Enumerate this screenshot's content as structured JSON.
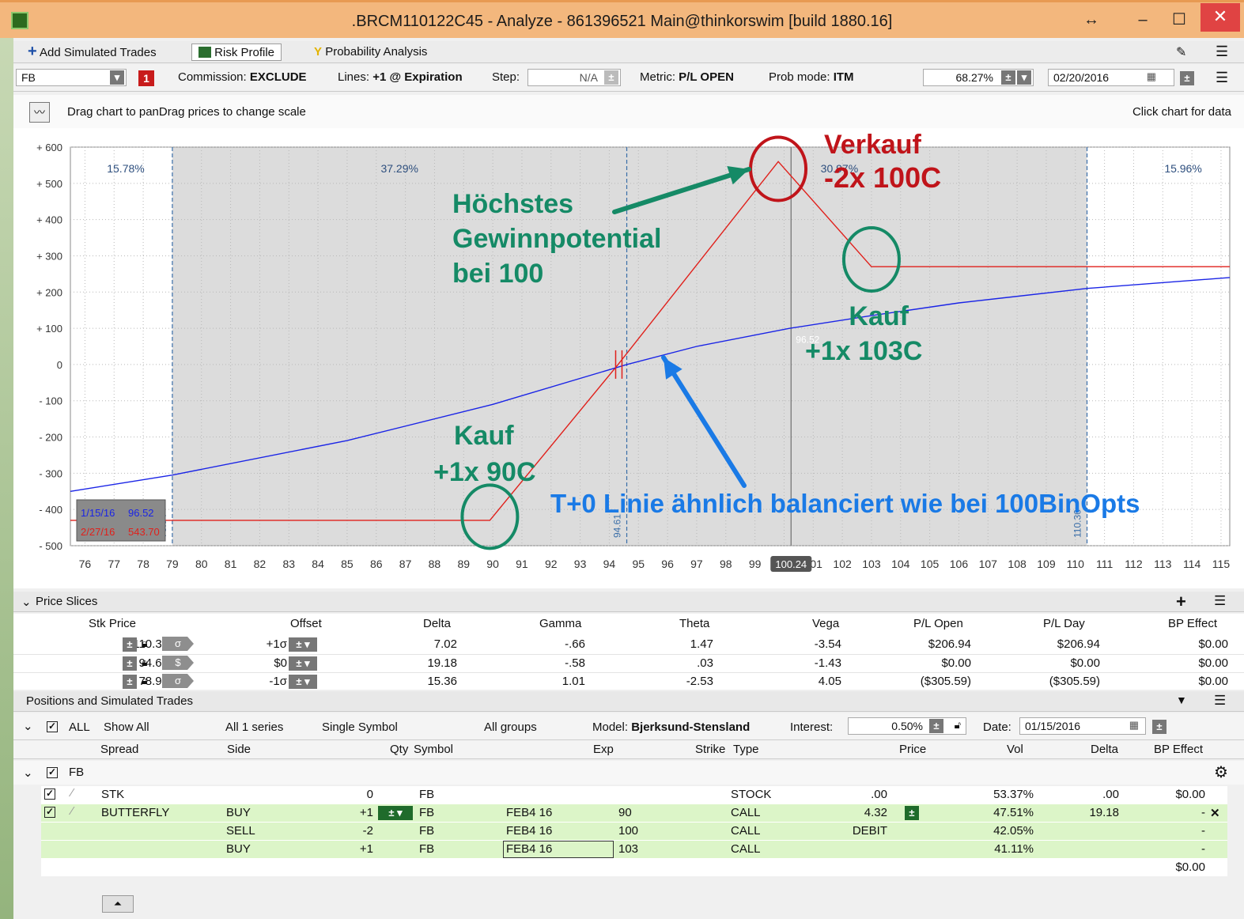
{
  "window": {
    "title": ".BRCM110122C45 - Analyze - 861396521 Main@thinkorswim [build 1880.16]",
    "resize_glyph": "↔",
    "minimize_glyph": "–",
    "maximize_glyph": "☐",
    "close_glyph": "✕"
  },
  "tabs": [
    {
      "label": "Add Simulated Trades",
      "icon": "plus-icon"
    },
    {
      "label": "Risk Profile",
      "icon": "risk-profile-icon"
    },
    {
      "label": "Probability Analysis",
      "icon": "probability-icon"
    }
  ],
  "controls": {
    "symbol": "FB",
    "badge": "1",
    "commission_label": "Commission:",
    "commission_value": "EXCLUDE",
    "lines_label": "Lines:",
    "lines_value": "+1 @ Expiration",
    "step_label": "Step:",
    "step_value": "N/A",
    "metric_label": "Metric:",
    "metric_value": "P/L OPEN",
    "probmode_label": "Prob mode:",
    "probmode_value": "ITM",
    "prob_pct": "68.27%",
    "date": "02/20/2016"
  },
  "hint": {
    "left": "Drag chart to panDrag prices to change scale",
    "right": "Click chart for data"
  },
  "chart_data": {
    "type": "line",
    "xlim": [
      75.5,
      115.3
    ],
    "ylim": [
      -500,
      600
    ],
    "x_ticks": [
      76,
      77,
      78,
      79,
      80,
      81,
      82,
      83,
      84,
      85,
      86,
      87,
      88,
      89,
      90,
      91,
      92,
      93,
      94,
      95,
      96,
      97,
      98,
      99,
      101,
      102,
      103,
      104,
      105,
      106,
      107,
      108,
      109,
      110,
      111,
      112,
      113,
      114,
      115
    ],
    "y_ticks": [
      600,
      500,
      400,
      300,
      200,
      100,
      0,
      -100,
      -200,
      -300,
      -400,
      -500
    ],
    "y_tick_labels": [
      "+ 600",
      "+ 500",
      "+ 400",
      "+ 300",
      "+ 200",
      "+ 100",
      "0",
      "- 100",
      "- 200",
      "- 300",
      "- 400",
      "- 500"
    ],
    "current_price": 100.24,
    "current_price_label": "100.24",
    "current_price_marker": "96.52",
    "sigma_lines": [
      {
        "x": 79.0,
        "label": "78.94"
      },
      {
        "x": 94.6,
        "label": "94.61"
      },
      {
        "x": 110.4,
        "label": "110.36"
      }
    ],
    "zone_percents": [
      {
        "x": 77.4,
        "label": "15.78%"
      },
      {
        "x": 86.8,
        "label": "37.29%"
      },
      {
        "x": 101.9,
        "label": "30.97%"
      },
      {
        "x": 113.7,
        "label": "15.96%"
      }
    ],
    "series": [
      {
        "name": "2/27/16",
        "color": "#e0201b",
        "x": [
          75.5,
          89.9,
          94.3,
          99.8,
          103.0,
          115.3
        ],
        "y": [
          -430,
          -430,
          0,
          560,
          270,
          270
        ]
      },
      {
        "name": "1/15/16",
        "color": "#1a24e6",
        "x": [
          75.5,
          79,
          85,
          90,
          94.6,
          97,
          100.2,
          103,
          106,
          110.4,
          115.3
        ],
        "y": [
          -350,
          -305,
          -210,
          -110,
          0,
          50,
          100,
          135,
          170,
          210,
          240
        ]
      }
    ],
    "legend": [
      {
        "date": "1/15/16",
        "value": "96.52",
        "color": "#1a24e6"
      },
      {
        "date": "2/27/16",
        "value": "543.70",
        "color": "#e0201b"
      }
    ]
  },
  "annotations": {
    "verkauf": {
      "line1": "Verkauf",
      "line2": "-2x 100C",
      "color": "#c0141a"
    },
    "hoechstes": {
      "line1": "Höchstes",
      "line2": "Gewinnpotential",
      "line3": "bei 100",
      "color": "#158a66"
    },
    "kauf103": {
      "line1": "Kauf",
      "line2": "+1x 103C",
      "color": "#158a66"
    },
    "kauf90": {
      "line1": "Kauf",
      "line2": "+1x 90C",
      "color": "#158a66"
    },
    "t0": {
      "text": "T+0 Linie ähnlich balanciert wie bei 100BinOpts",
      "color": "#1a7ae6"
    }
  },
  "price_slices": {
    "header": "Price Slices",
    "columns": [
      "Stk Price",
      "Offset",
      "Delta",
      "Gamma",
      "Theta",
      "Vega",
      "P/L Open",
      "P/L Day",
      "BP Effect"
    ],
    "rows": [
      {
        "price": "110.36",
        "mode": "σ",
        "offset": "+1σ",
        "delta": "7.02",
        "gamma": "-.66",
        "theta": "1.47",
        "vega": "-3.54",
        "pl_open": "$206.94",
        "pl_day": "$206.94",
        "bp": "$0.00"
      },
      {
        "price": "94.61",
        "mode": "$",
        "offset": "$0",
        "delta": "19.18",
        "gamma": "-.58",
        "theta": ".03",
        "vega": "-1.43",
        "pl_open": "$0.00",
        "pl_day": "$0.00",
        "bp": "$0.00"
      },
      {
        "price": "78.94",
        "mode": "σ",
        "offset": "-1σ",
        "delta": "15.36",
        "gamma": "1.01",
        "theta": "-2.53",
        "vega": "4.05",
        "pl_open": "($305.59)",
        "pl_day": "($305.59)",
        "bp": "$0.00"
      }
    ]
  },
  "positions": {
    "header": "Positions and Simulated Trades",
    "filters": {
      "all": "ALL",
      "show": "Show All",
      "series": "All 1 series",
      "symbol": "Single Symbol",
      "groups": "All groups",
      "model_label": "Model:",
      "model_value": "Bjerksund-Stensland",
      "interest_label": "Interest:",
      "interest_value": "0.50%",
      "date_label": "Date:",
      "date_value": "01/15/2016"
    },
    "columns": [
      "Spread",
      "Side",
      "Qty",
      "Symbol",
      "Exp",
      "Strike",
      "Type",
      "Price",
      "Vol",
      "Delta",
      "BP Effect"
    ],
    "group": "FB",
    "rows": [
      {
        "spread": "STK",
        "side": "",
        "qty": "0",
        "symbol": "FB",
        "exp": "",
        "strike": "",
        "type": "STOCK",
        "price": ".00",
        "vol": "53.37%",
        "delta": ".00",
        "bp": "$0.00"
      },
      {
        "spread": "BUTTERFLY",
        "side": "BUY",
        "qty": "+1",
        "symbol": "FB",
        "exp": "FEB4 16",
        "strike": "90",
        "type": "CALL",
        "price": "4.32",
        "vol": "47.51%",
        "delta": "19.18",
        "bp": "-"
      },
      {
        "spread": "",
        "side": "SELL",
        "qty": "-2",
        "symbol": "FB",
        "exp": "FEB4 16",
        "strike": "100",
        "type": "CALL",
        "price": "DEBIT",
        "vol": "42.05%",
        "delta": "",
        "bp": "-"
      },
      {
        "spread": "",
        "side": "BUY",
        "qty": "+1",
        "symbol": "FB",
        "exp": "FEB4 16",
        "strike": "103",
        "type": "CALL",
        "price": "",
        "vol": "41.11%",
        "delta": "",
        "bp": "-"
      }
    ],
    "total_bp": "$0.00"
  }
}
